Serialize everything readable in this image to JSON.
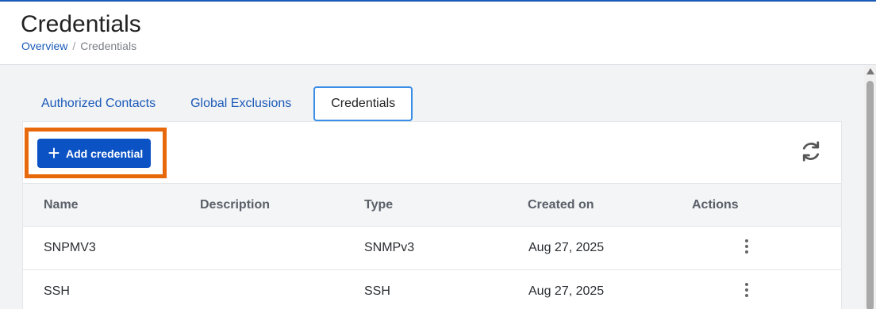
{
  "header": {
    "title": "Credentials",
    "breadcrumb": {
      "home": "Overview",
      "separator": "/",
      "current": "Credentials"
    }
  },
  "tabs": [
    {
      "label": "Authorized Contacts"
    },
    {
      "label": "Global Exclusions"
    },
    {
      "label": "Credentials"
    }
  ],
  "toolbar": {
    "add_label": "Add credential",
    "refresh_icon": "refresh-icon"
  },
  "table": {
    "columns": [
      "Name",
      "Description",
      "Type",
      "Created on",
      "Actions"
    ],
    "rows": [
      {
        "name": "SNPMV3",
        "description": "",
        "type": "SNMPv3",
        "created": "Aug 27, 2025"
      },
      {
        "name": "SSH",
        "description": "",
        "type": "SSH",
        "created": "Aug 27, 2025"
      }
    ]
  },
  "colors": {
    "accent": "#0b52c4",
    "highlight": "#e8690b",
    "active_tab_border": "#3a8ee6"
  }
}
